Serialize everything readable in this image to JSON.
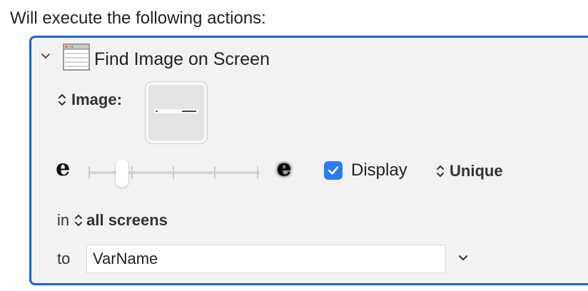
{
  "header": {
    "text": "Will execute the following actions:"
  },
  "action": {
    "title": "Find Image on Screen",
    "icon": "window-icon",
    "image_label": "Image:",
    "display_label": "Display",
    "display_checked": true,
    "unique_label": "Unique",
    "in_label": "in",
    "screens_value": "all screens",
    "to_label": "to",
    "variable_value": "VarName",
    "fuzz_low_glyph": "e",
    "fuzz_high_glyph": "e",
    "fuzz_level": 0.16
  },
  "colors": {
    "accent": "#1f62d6",
    "checkbox": "#2a7cf6",
    "panel_bg": "#f2f2f2"
  }
}
